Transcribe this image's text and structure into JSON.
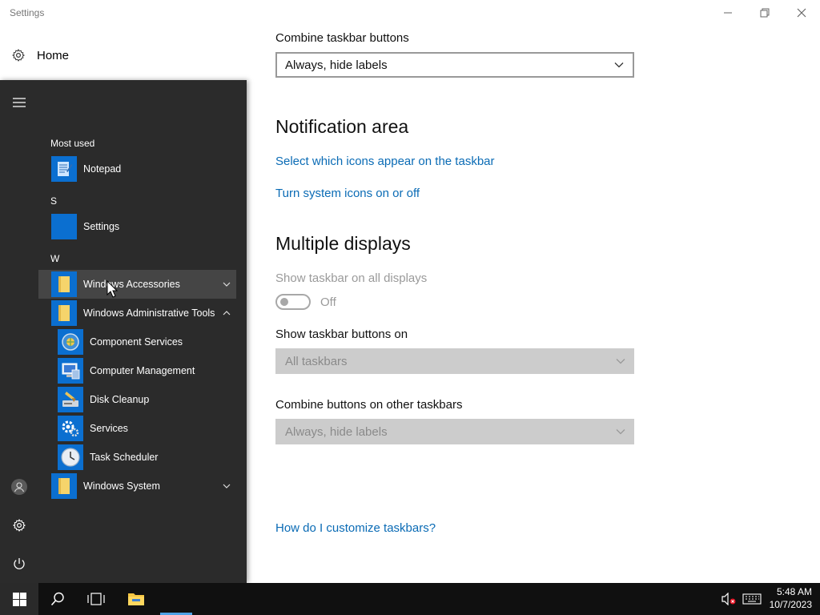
{
  "window": {
    "title": "Settings",
    "minimize_glyph": "—",
    "restore_glyph": "❐",
    "close_glyph": "✕"
  },
  "nav": {
    "home_label": "Home",
    "home_icon": "gear-icon"
  },
  "content": {
    "combine_label": "Combine taskbar buttons",
    "combine_value": "Always, hide labels",
    "notification_heading": "Notification area",
    "link_select_icons": "Select which icons appear on the taskbar",
    "link_system_icons": "Turn system icons on or off",
    "multiple_heading": "Multiple displays",
    "show_all_label": "Show taskbar on all displays",
    "show_all_state": "Off",
    "show_buttons_label": "Show taskbar buttons on",
    "show_buttons_value": "All taskbars",
    "combine_other_label": "Combine buttons on other taskbars",
    "combine_other_value": "Always, hide labels",
    "help_link": "How do I customize taskbars?"
  },
  "start_menu": {
    "most_used_header": "Most used",
    "section_s": "S",
    "section_w": "W",
    "apps": {
      "notepad": "Notepad",
      "settings": "Settings",
      "windows_accessories": "Windows Accessories",
      "windows_admin_tools": "Windows Administrative Tools",
      "component_services": "Component Services",
      "computer_management": "Computer Management",
      "disk_cleanup": "Disk Cleanup",
      "services": "Services",
      "task_scheduler": "Task Scheduler",
      "windows_system": "Windows System"
    }
  },
  "taskbar": {
    "time": "5:48 AM",
    "date": "10/7/2023"
  },
  "colors": {
    "accent": "#0b6fd0",
    "link": "#0a6bb5",
    "start_bg": "#2b2b2b",
    "taskbar_bg": "#101010"
  }
}
